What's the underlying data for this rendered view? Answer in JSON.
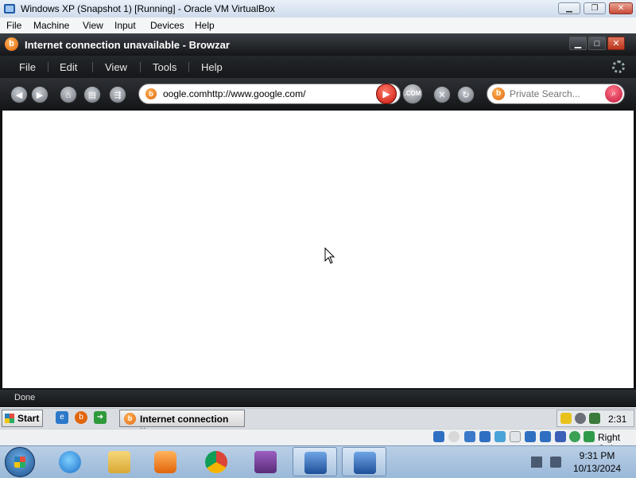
{
  "host_window": {
    "title": "Windows XP (Snapshot 1) [Running] - Oracle VM VirtualBox",
    "menu": [
      "File",
      "Machine",
      "View",
      "Input",
      "Devices",
      "Help"
    ]
  },
  "browser": {
    "title": "Internet connection unavailable - Browzar",
    "logo_letter": "b",
    "menu": [
      "File",
      "Edit",
      "View",
      "Tools",
      "Help"
    ],
    "address_value": "oogle.comhttp://www.google.com/",
    "com_label": ".COM",
    "search_placeholder": "Private Search...",
    "status": "Done"
  },
  "xp_taskbar": {
    "start_label": "Start",
    "task_label": "Internet connection u...",
    "clock": "2:31"
  },
  "vbox_statusbar": {
    "host_key": "Right Ctrl"
  },
  "win7_taskbar": {
    "time": "9:31 PM",
    "date": "10/13/2024",
    "apps": [
      "internet-explorer",
      "file-explorer",
      "media-player",
      "chrome",
      "winrar",
      "virtualbox",
      "windows-xp-vm"
    ]
  },
  "colors": {
    "browser_chrome": "#141618",
    "accent_orange": "#e2650b",
    "go_red": "#c9150a",
    "w7_taskbar": "#9ab8d8"
  }
}
